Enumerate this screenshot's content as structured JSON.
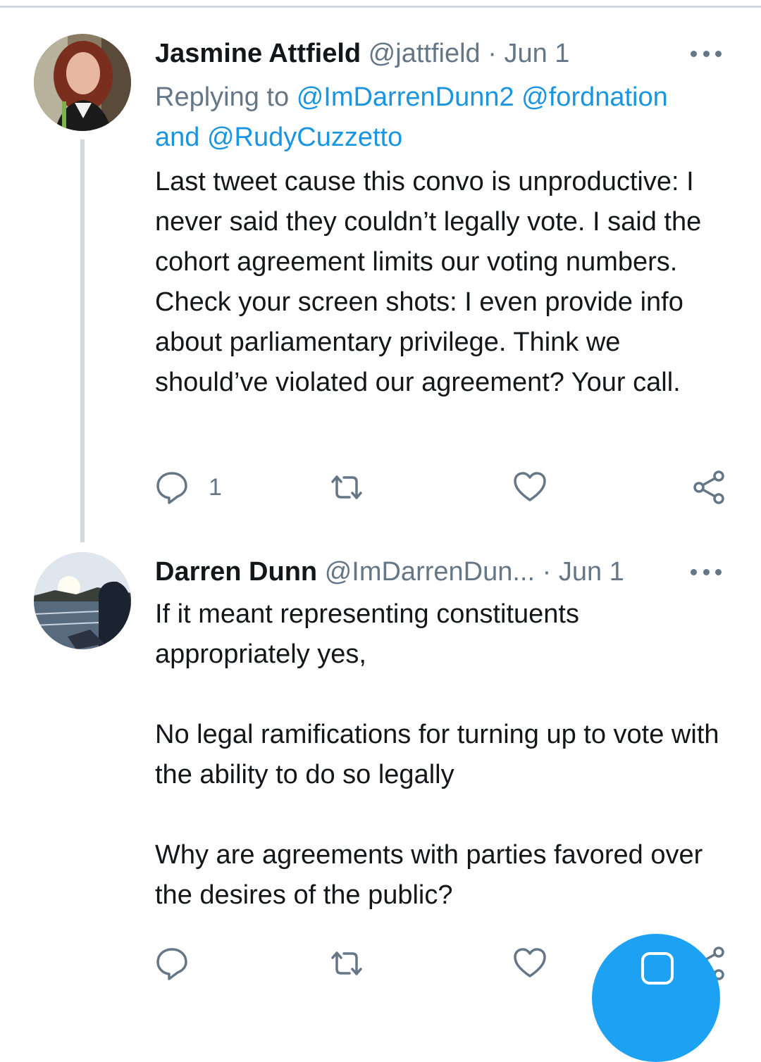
{
  "tweets": [
    {
      "author_name": "Jasmine Attfield",
      "handle": "@jattfield",
      "separator": "·",
      "date": "Jun 1",
      "reply_prefix": "Replying to",
      "reply_mentions": [
        "@ImDarrenDunn2",
        "@fordnation"
      ],
      "reply_conjunction": "and",
      "reply_last_mention": "@RudyCuzzetto",
      "paragraphs": [
        "Last tweet cause this convo is unproductive: I never said they couldn’t legally vote. I said the cohort agreement limits our voting numbers. Check your screen shots: I even provide info about parliamentary privilege. Think we should’ve violated our agreement? Your call."
      ],
      "reply_count": "1",
      "icons": {
        "avatar": "profile-photo-woman",
        "more": "more-dots-icon",
        "reply": "comment-icon",
        "retweet": "retweet-icon",
        "like": "heart-icon",
        "share": "share-icon"
      }
    },
    {
      "author_name": "Darren Dunn",
      "handle": "@ImDarrenDun...",
      "separator": "·",
      "date": "Jun 1",
      "paragraphs": [
        "If it meant representing constituents appropriately yes,",
        "No legal ramifications for turning up to vote with the ability to do so legally",
        "Why are agreements with parties favored over the desires of the public?"
      ],
      "icons": {
        "avatar": "profile-photo-lake-sunset",
        "more": "more-dots-icon",
        "reply": "comment-icon",
        "retweet": "retweet-icon",
        "like": "heart-icon",
        "share": "share-icon"
      }
    }
  ],
  "fab": {
    "icon": "compose-icon",
    "color": "#1da1f2"
  },
  "colors": {
    "link": "#1b95e0",
    "secondary_text": "#657786",
    "primary_text": "#14171a",
    "divider": "#cfd9de"
  }
}
